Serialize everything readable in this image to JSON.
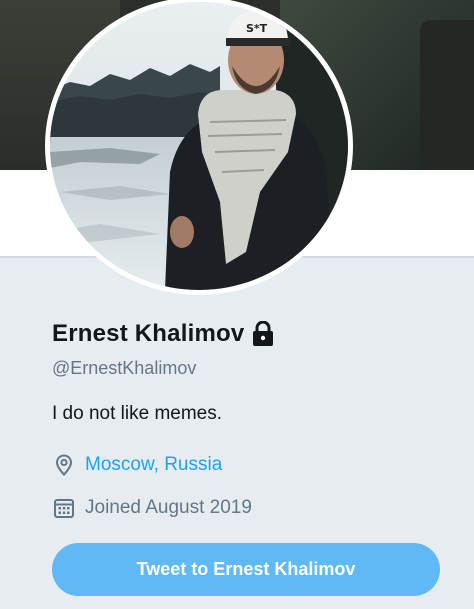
{
  "profile": {
    "display_name": "Ernest Khalimov",
    "protected_icon": "lock-icon",
    "handle": "@ErnestKhalimov",
    "bio": "I do not like memes.",
    "location": "Moscow, Russia",
    "location_icon": "location-pin-icon",
    "joined": "Joined August 2019",
    "joined_icon": "calendar-icon",
    "cap_text": "S*T"
  },
  "actions": {
    "tweet_to_label": "Tweet to Ernest Khalimov"
  },
  "colors": {
    "link": "#1da1f2",
    "button": "#60b8f5",
    "secondary_text": "#657786",
    "primary_text": "#14171a",
    "background": "#e6ecf0"
  }
}
